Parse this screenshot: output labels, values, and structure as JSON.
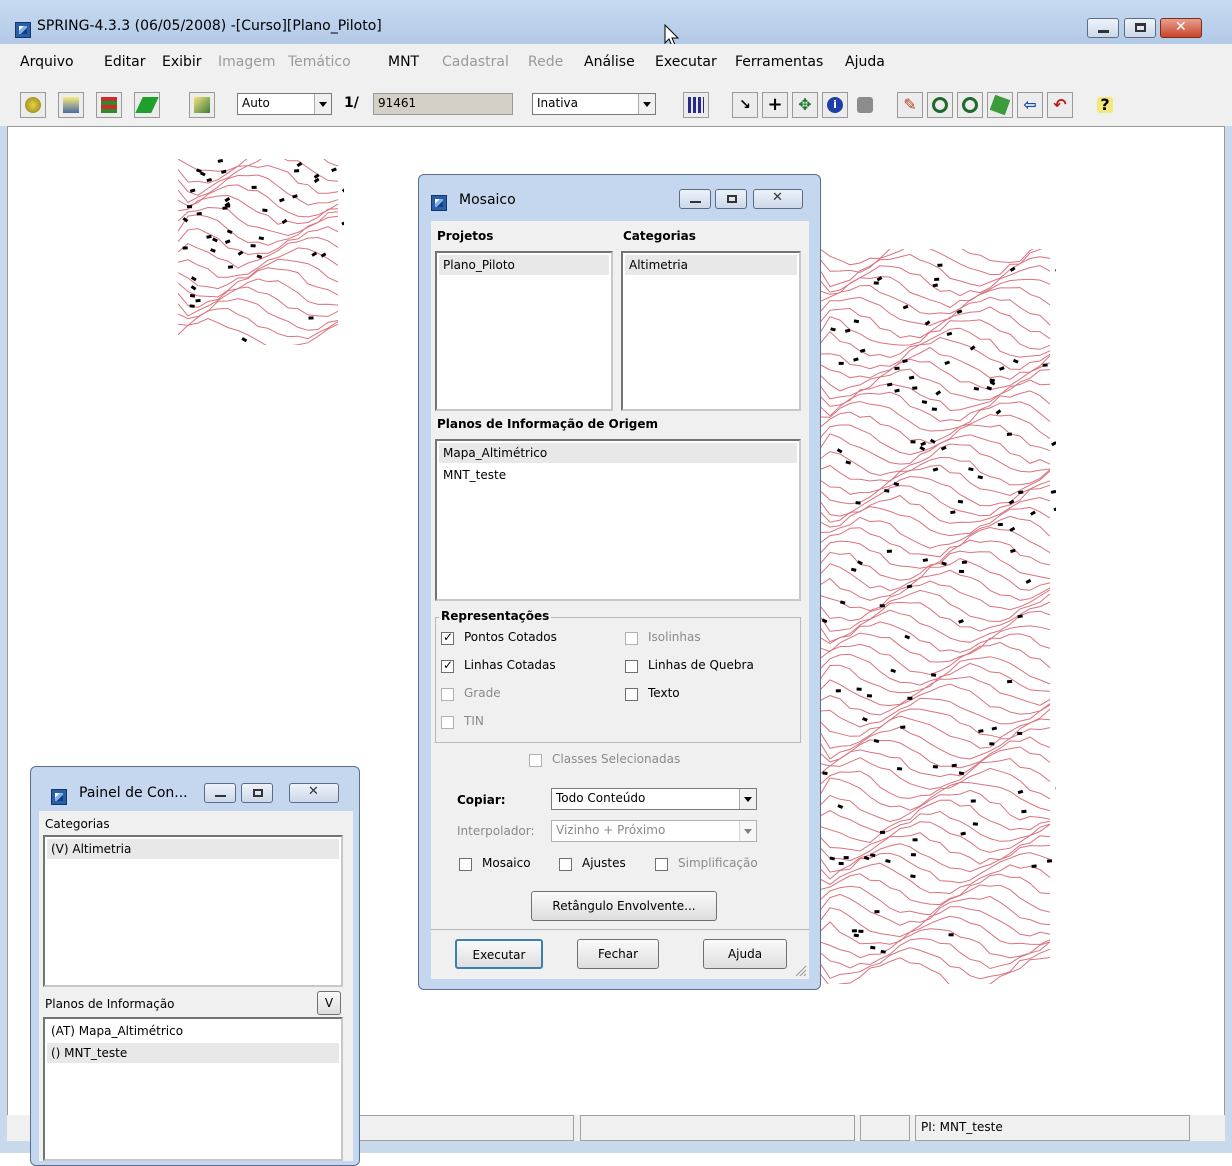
{
  "window": {
    "title": "SPRING-4.3.3 (06/05/2008) -[Curso][Plano_Piloto]"
  },
  "menu": [
    {
      "label": "Arquivo",
      "enabled": true
    },
    {
      "label": "Editar",
      "enabled": true
    },
    {
      "label": "Exibir",
      "enabled": true
    },
    {
      "label": "Imagem",
      "enabled": false
    },
    {
      "label": "Temático",
      "enabled": false
    },
    {
      "label": "MNT",
      "enabled": true
    },
    {
      "label": "Cadastral",
      "enabled": false
    },
    {
      "label": "Rede",
      "enabled": false
    },
    {
      "label": "Análise",
      "enabled": true
    },
    {
      "label": "Executar",
      "enabled": true
    },
    {
      "label": "Ferramentas",
      "enabled": true
    },
    {
      "label": "Ajuda",
      "enabled": true
    }
  ],
  "toolbar": {
    "scale_mode": "Auto",
    "scale_prefix": "1/",
    "scale_value": "91461",
    "cursor_mode": "Inativa",
    "help_icon": "?"
  },
  "mosaico": {
    "title": "Mosaico",
    "projetos_label": "Projetos",
    "categorias_label": "Categorias",
    "projetos": [
      "Plano_Piloto"
    ],
    "categorias": [
      "Altimetria"
    ],
    "planos_label": "Planos de Informação de Origem",
    "planos": [
      "Mapa_Altimétrico",
      "MNT_teste"
    ],
    "representacoes_label": "Representações",
    "reps": {
      "pontos_cotados": "Pontos Cotados",
      "isolinhas": "Isolinhas",
      "linhas_cotadas": "Linhas Cotadas",
      "linhas_quebra": "Linhas de Quebra",
      "grade": "Grade",
      "texto": "Texto",
      "tin": "TIN"
    },
    "classes_selecionadas": "Classes Selecionadas",
    "copiar_label": "Copiar:",
    "copiar_value": "Todo Conteúdo",
    "interpolador_label": "Interpolador:",
    "interpolador_value": "Vizinho + Próximo",
    "mosaico_chk": "Mosaico",
    "ajustes_chk": "Ajustes",
    "simplificacao_chk": "Simplificação",
    "retangulo_btn": "Retângulo Envolvente...",
    "executar_btn": "Executar",
    "fechar_btn": "Fechar",
    "ajuda_btn": "Ajuda"
  },
  "painel": {
    "title": "Painel de Con...",
    "categorias_label": "Categorias",
    "categorias": [
      "(V) Altimetria"
    ],
    "planos_label": "Planos de Informação",
    "planos_btn": "V",
    "planos": [
      "(AT) Mapa_Altimétrico",
      "() MNT_teste"
    ]
  },
  "statusbar": {
    "pi": "PI: MNT_teste"
  },
  "colors": {
    "contour": "#d9737e",
    "title_bg": "#c5d7ee",
    "close_button": "#c8442c"
  }
}
